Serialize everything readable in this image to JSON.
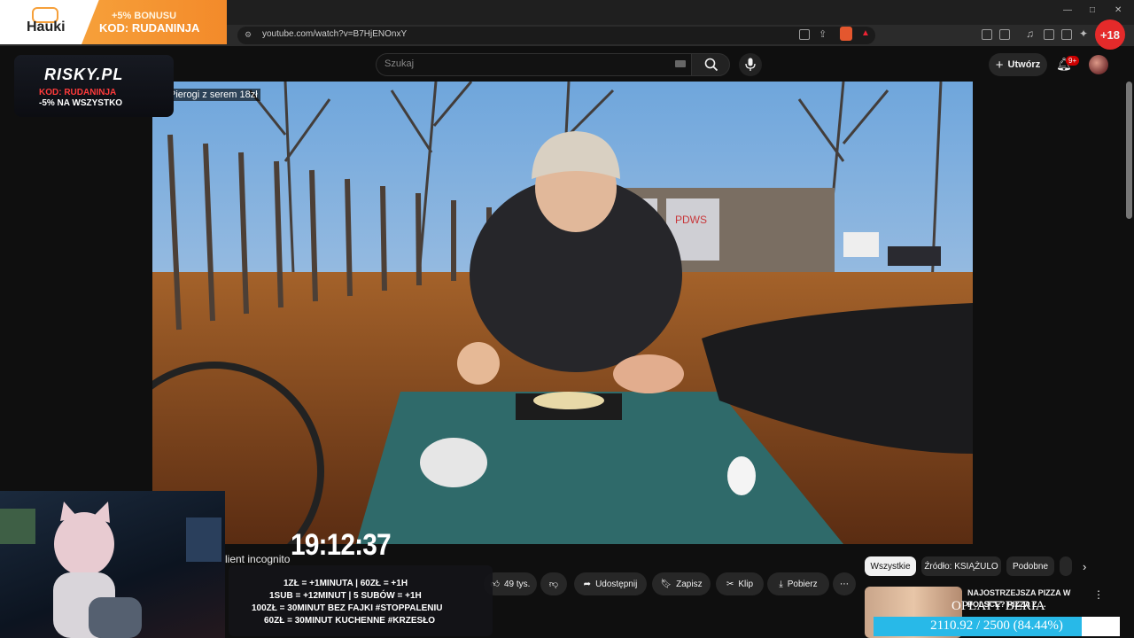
{
  "overlay": {
    "hauki_logo": "Hauki",
    "hauki_bonus": "+5% BONUSU",
    "hauki_code": "KOD: RUDANINJA",
    "plus18": "+18",
    "risky_logo": "RISKY.PL",
    "risky_code": "KOD: RUDANINJA",
    "risky_discount": "-5% NA WSZYSTKO",
    "clock": "19:12:37",
    "client_text": "lient incognito",
    "rules": [
      "1ZŁ = +1MINUTA | 60ZŁ = +1H",
      "1SUB = +12MINUT | 5 SUBÓW = +1H",
      "100ZŁ = 30MINUT BEZ FAJKI #STOPPALENIU",
      "60ZŁ = 30MINUT KUCHENNE #KRZESŁO"
    ],
    "opaty": "OPŁATY BERIA",
    "progress_text": "2110.92 / 2500 (84.44%)",
    "progress_fraction": 0.8444
  },
  "browser": {
    "url": "youtube.com/watch?v=B7HjENOnxY"
  },
  "youtube": {
    "search_placeholder": "Szukaj",
    "create_label": "Utwórz",
    "notifications_badge": "9+",
    "video_caption": "Pierogi z serem 18zł",
    "actions": {
      "likes": "49 tys.",
      "share": "Udostępnij",
      "save": "Zapisz",
      "clip": "Klip",
      "download": "Pobierz"
    },
    "chips": [
      "Wszystkie",
      "Źródło: KSIĄŻULO",
      "Podobne"
    ],
    "recommendation": {
      "title_line1": "NAJOSTRZEJSZA PIZZA W",
      "title_line2": "POLSCE? PIZZA Z ..."
    }
  },
  "colors": {
    "youtube_bg": "#0f0f0f",
    "accent_orange": "#f6a03a",
    "progress_fill": "#28b9e8",
    "badge_red": "#cc0000"
  }
}
